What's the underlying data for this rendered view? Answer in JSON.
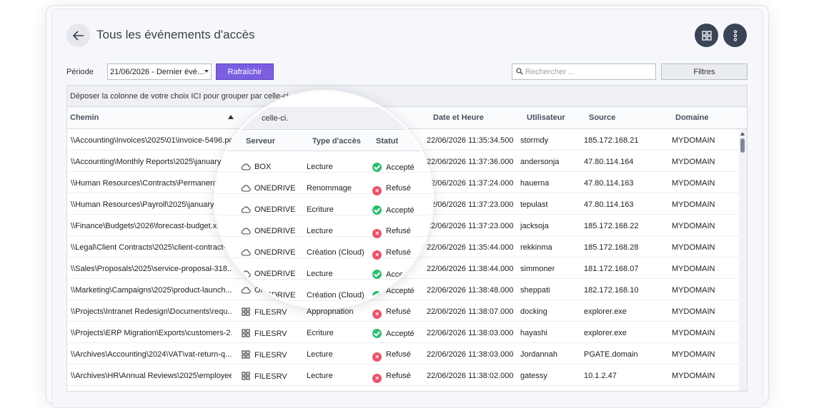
{
  "page": {
    "title": "Tous les événements d'accès",
    "period_label": "Période",
    "period_value": "21/06/2026 - Dernier évé…",
    "refresh_label": "Rafraîchir",
    "search_placeholder": "Rechercher ...",
    "filters_label": "Filtres",
    "group_hint": "Déposer la colonne de votre choix ICI pour grouper par celle-ci."
  },
  "columns": {
    "path": "Chemin",
    "server": "Serveur",
    "access_type": "Type d'accès",
    "status": "Statut",
    "date": "Date et Heure",
    "user": "Utilisateur",
    "source": "Source",
    "domain": "Domaine"
  },
  "rows": [
    {
      "path": "\\\\Accounting\\Invoices\\2025\\01\\invoice-5496.pdf",
      "server": "BOX",
      "server_type": "cloud",
      "access": "Lecture",
      "status": "Accepté",
      "ok": true,
      "date": "22/06/2026 11:35:34.500",
      "user": "stormdy",
      "source": "185.172.168.21",
      "domain": "MYDOMAIN"
    },
    {
      "path": "\\\\Accounting\\Monthly Reports\\2025\\january-report.xlsx",
      "server": "ONEDRIVE",
      "server_type": "cloud",
      "access": "Renommage",
      "status": "Refusé",
      "ok": false,
      "date": "22/06/2026 11:37:36.000",
      "user": "andersonja",
      "source": "47.80.114.164",
      "domain": "MYDOMAIN"
    },
    {
      "path": "\\\\Human Resources\\Contracts\\Permanent\\employee.docx",
      "server": "ONEDRIVE",
      "server_type": "cloud",
      "access": "Ecriture",
      "status": "Accepté",
      "ok": true,
      "date": "22/06/2026 11:37:24.000",
      "user": "hauerna",
      "source": "47.80.114.163",
      "domain": "MYDOMAIN"
    },
    {
      "path": "\\\\Human Resources\\Payroll\\2025\\january-payroll.xlsx",
      "server": "ONEDRIVE",
      "server_type": "cloud",
      "access": "Lecture",
      "status": "Refusé",
      "ok": false,
      "date": "22/06/2026 11:37:23.000",
      "user": "tepulast",
      "source": "47.80.114.163",
      "domain": "MYDOMAIN"
    },
    {
      "path": "\\\\Finance\\Budgets\\2026\\forecast-budget.xlsx",
      "server": "ONEDRIVE",
      "server_type": "cloud",
      "access": "Création (Cloud)",
      "status": "Refusé",
      "ok": false,
      "date": "22/06/2026 11:37:23.000",
      "user": "jacksoja",
      "source": "185.172.168.22",
      "domain": "MYDOMAIN"
    },
    {
      "path": "\\\\Legal\\Client Contracts\\2025\\client-contract-...",
      "server": "ONEDRIVE",
      "server_type": "cloud",
      "access": "Lecture",
      "status": "Accepté",
      "ok": true,
      "date": "22/06/2026 11:35:44.000",
      "user": "rekkinma",
      "source": "185.172.168.28",
      "domain": "MYDOMAIN"
    },
    {
      "path": "\\\\Sales\\Proposals\\2025\\service-proposal-318...",
      "server": "ONEDRIVE",
      "server_type": "cloud",
      "access": "Création (Cloud)",
      "status": "Accepté",
      "ok": true,
      "date": "22/06/2026 11:38:44.000",
      "user": "simmoner",
      "source": "181.172.168.07",
      "domain": "MYDOMAIN"
    },
    {
      "path": "\\\\Marketing\\Campaigns\\2025\\product-launch...",
      "server": "ONEDRIVE",
      "server_type": "cloud",
      "access": "Création (Cloud)",
      "status": "Accepté",
      "ok": true,
      "date": "22/06/2026 11:38:48.000",
      "user": "sheppati",
      "source": "182.172.168.10",
      "domain": "MYDOMAIN"
    },
    {
      "path": "\\\\Projects\\Intranet Redesign\\Documents\\requ...",
      "server": "FILESRV",
      "server_type": "windows",
      "access": "Appropriation",
      "status": "Refusé",
      "ok": false,
      "date": "22/06/2026 11:38:07.000",
      "user": "docking",
      "source": "explorer.exe",
      "domain": "MYDOMAIN"
    },
    {
      "path": "\\\\Projects\\ERP Migration\\Exports\\customers-2...",
      "server": "FILESRV",
      "server_type": "windows",
      "access": "Ecriture",
      "status": "Accepté",
      "ok": true,
      "date": "22/06/2026 11:38:03.000",
      "user": "hayashi",
      "source": "explorer.exe",
      "domain": "MYDOMAIN"
    },
    {
      "path": "\\\\Archives\\Accounting\\2024\\VAT\\vat-return-q...",
      "server": "FILESRV",
      "server_type": "windows",
      "access": "Lecture",
      "status": "Refusé",
      "ok": false,
      "date": "22/06/2026 11:38:03.000",
      "user": "Jordannah",
      "source": "PGATE.domain",
      "domain": "MYDOMAIN"
    },
    {
      "path": "\\\\Archives\\HR\\Annual Reviews\\2025\\employee...",
      "server": "FILESRV",
      "server_type": "windows",
      "access": "Lecture",
      "status": "Refusé",
      "ok": false,
      "date": "22/06/2026 11:38:02.000",
      "user": "gatessy",
      "source": "10.1.2.47",
      "domain": "MYDOMAIN"
    }
  ],
  "lens": {
    "hint_fragment": "celle-ci.",
    "rows": [
      {
        "server": "BOX",
        "server_type": "cloud",
        "access": "Lecture",
        "status": "Accepté",
        "ok": true
      },
      {
        "server": "ONEDRIVE",
        "server_type": "cloud",
        "access": "Renommage",
        "status": "Refusé",
        "ok": false
      },
      {
        "server": "ONEDRIVE",
        "server_type": "cloud",
        "access": "Ecriture",
        "status": "Accepté",
        "ok": true
      },
      {
        "server": "ONEDRIVE",
        "server_type": "cloud",
        "access": "Lecture",
        "status": "Refusé",
        "ok": false
      },
      {
        "server": "ONEDRIVE",
        "server_type": "cloud",
        "access": "Création (Cloud)",
        "status": "Refusé",
        "ok": false
      },
      {
        "server": "ONEDRIVE",
        "server_type": "cloud",
        "access": "Lecture",
        "status": "Accepté",
        "ok": true
      },
      {
        "server": "ONEDRIVE",
        "server_type": "cloud",
        "access": "Création (Cloud)",
        "status": "Accepté",
        "ok": true
      }
    ]
  },
  "colors": {
    "accent": "#7b5fe0",
    "ok": "#2dbd6e",
    "ko": "#e8546a",
    "dark_button": "#3b4456"
  },
  "icons": {
    "back": "arrow-left-icon",
    "grid": "grid-icon",
    "menu": "more-vertical-icon",
    "search": "search-icon",
    "cloud": "cloud-icon",
    "windows": "windows-server-icon"
  }
}
